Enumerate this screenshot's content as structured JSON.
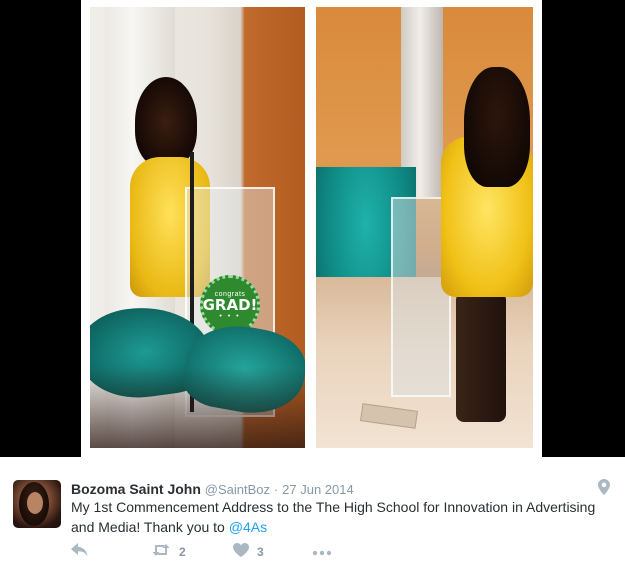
{
  "media": {
    "badge": {
      "top_text": "congrats",
      "main_text": "GRAD!",
      "dots": "• • •"
    }
  },
  "tweet": {
    "author_name": "Bozoma Saint John",
    "handle": "@SaintBoz",
    "separator": "·",
    "date": "27 Jun 2014",
    "text_before_mention": "My 1st Commencement Address to the The High School for Innovation in Advertising and Media!  Thank you to ",
    "mention": "@4As",
    "actions": {
      "reply_icon": "reply-icon",
      "retweet_icon": "retweet-icon",
      "retweet_count": "2",
      "like_icon": "heart-icon",
      "like_count": "3",
      "more_icon": "more-icon"
    },
    "location_icon": "location-pin-icon"
  },
  "colors": {
    "link": "#1da1f2",
    "muted": "#8899a6",
    "text": "#292f33",
    "icon": "#aab8c2"
  }
}
